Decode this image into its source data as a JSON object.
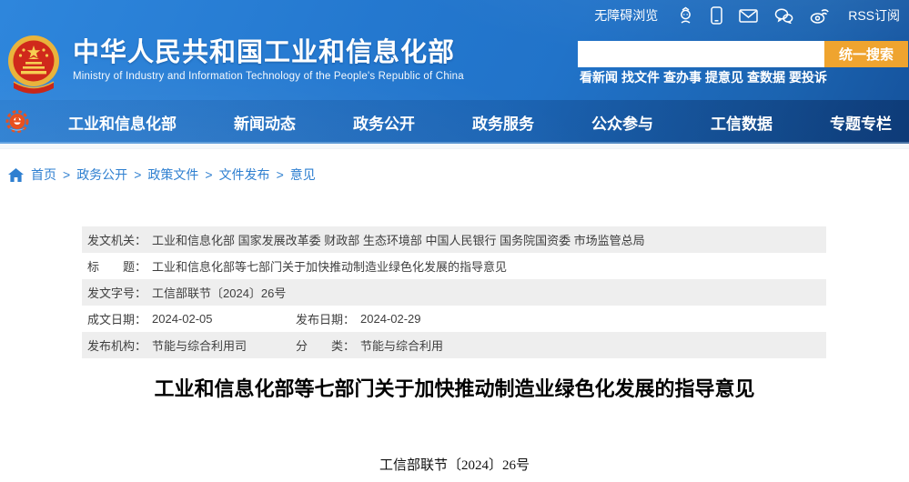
{
  "topbar": {
    "accessibility_label": "无障碍浏览",
    "rss_label": "RSS订阅"
  },
  "header": {
    "site_title": "中华人民共和国工业和信息化部",
    "site_subtitle": "Ministry of Industry and Information Technology of the People's Republic of China"
  },
  "search": {
    "input_value": "",
    "button_label": "统一搜索",
    "quick_links": [
      "看新闻",
      "找文件",
      "查办事",
      "提意见",
      "查数据",
      "要投诉"
    ]
  },
  "nav": {
    "items": [
      "工业和信息化部",
      "新闻动态",
      "政务公开",
      "政务服务",
      "公众参与",
      "工信数据",
      "专题专栏"
    ]
  },
  "breadcrumb": {
    "separator": ">",
    "items": [
      "首页",
      "政务公开",
      "政策文件",
      "文件发布",
      "意见"
    ]
  },
  "meta_table": {
    "rows": [
      {
        "cells": [
          {
            "label": "发文机关",
            "value": "工业和信息化部 国家发展改革委 财政部 生态环境部 中国人民银行 国务院国资委 市场监管总局"
          }
        ]
      },
      {
        "cells": [
          {
            "label": "标题",
            "value": "工业和信息化部等七部门关于加快推动制造业绿色化发展的指导意见"
          }
        ]
      },
      {
        "cells": [
          {
            "label": "发文字号",
            "value": "工信部联节〔2024〕26号"
          }
        ]
      },
      {
        "cells": [
          {
            "label": "成文日期",
            "value": "2024-02-05"
          },
          {
            "label": "发布日期",
            "value": "2024-02-29"
          }
        ]
      },
      {
        "cells": [
          {
            "label": "发布机构",
            "value": "节能与综合利用司"
          },
          {
            "label": "分类",
            "value": "节能与综合利用"
          }
        ]
      }
    ]
  },
  "document": {
    "title": "工业和信息化部等七部门关于加快推动制造业绿色化发展的指导意见",
    "number": "工信部联节〔2024〕26号"
  },
  "colors": {
    "banner_blue_top": "#2b84da",
    "banner_blue_bottom": "#15529c",
    "search_button_orange": "#efa42f",
    "link_blue": "#2e7fd0",
    "table_row_gray": "#eeeeee",
    "table_text": "#3e3e3e"
  }
}
